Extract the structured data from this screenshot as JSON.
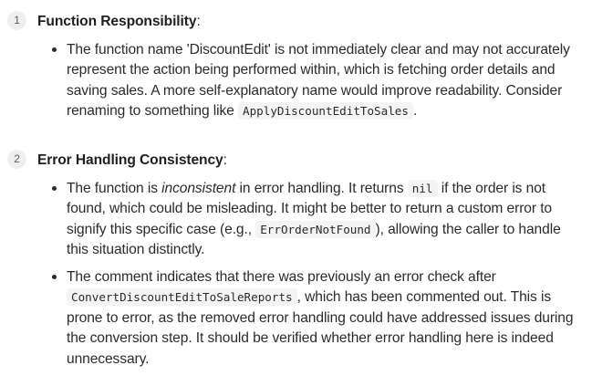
{
  "sections": [
    {
      "number": "1",
      "title": "Function Responsibility",
      "title_suffix": ":",
      "bullets": [
        {
          "parts": [
            {
              "type": "text",
              "value": "The function name 'DiscountEdit' is not immediately clear and may not accurately represent the action being performed within, which is fetching order details and saving sales. A more self-explanatory name would improve readability. Consider renaming to something like "
            },
            {
              "type": "code",
              "value": "ApplyDiscountEditToSales"
            },
            {
              "type": "text",
              "value": "."
            }
          ]
        }
      ]
    },
    {
      "number": "2",
      "title": "Error Handling Consistency",
      "title_suffix": ":",
      "bullets": [
        {
          "parts": [
            {
              "type": "text",
              "value": "The function is "
            },
            {
              "type": "em",
              "value": "inconsistent"
            },
            {
              "type": "text",
              "value": " in error handling. It returns "
            },
            {
              "type": "code",
              "value": "nil"
            },
            {
              "type": "text",
              "value": " if the order is not found, which could be misleading. It might be better to return a custom error to signify this specific case (e.g., "
            },
            {
              "type": "code",
              "value": "ErrOrderNotFound"
            },
            {
              "type": "text",
              "value": "), allowing the caller to handle this situation distinctly."
            }
          ]
        },
        {
          "parts": [
            {
              "type": "text",
              "value": "The comment indicates that there was previously an error check after "
            },
            {
              "type": "code",
              "value": "ConvertDiscountEditToSaleReports"
            },
            {
              "type": "text",
              "value": ", which has been commented out. This is prone to error, as the removed error handling could have addressed issues during the conversion step. It should be verified whether error handling here is indeed unnecessary."
            }
          ]
        }
      ]
    }
  ]
}
